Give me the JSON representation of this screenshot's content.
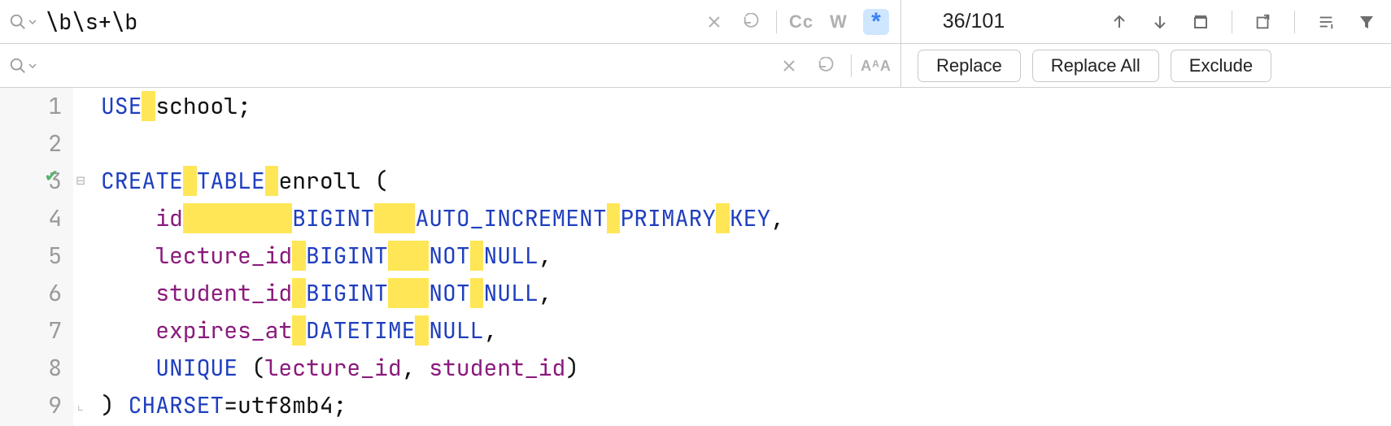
{
  "search": {
    "query": "\\b\\s+\\b",
    "match_count": "36/101",
    "cc_label": "Cc",
    "w_label": "W",
    "regex_label": "*"
  },
  "replace": {
    "value": "",
    "buttons": {
      "replace": "Replace",
      "replace_all": "Replace All",
      "exclude": "Exclude"
    },
    "aa_label": "AᴬA"
  },
  "gutter": {
    "lines": [
      "1",
      "2",
      "3",
      "4",
      "5",
      "6",
      "7",
      "8",
      "9"
    ]
  },
  "code": {
    "l1": {
      "a": "USE",
      "sp": " ",
      "b": "school",
      "c": ";"
    },
    "l2": {},
    "l3": {
      "a": "CREATE",
      "sp1": " ",
      "b": "TABLE",
      "sp2": " ",
      "c": "enroll",
      "d": " ("
    },
    "l4": {
      "indent": "    ",
      "a": "id",
      "sp1": "        ",
      "b": "BIGINT",
      "sp2": "   ",
      "c": "AUTO_INCREMENT",
      "sp3": " ",
      "d": "PRIMARY",
      "sp4": " ",
      "e": "KEY",
      "f": ","
    },
    "l5": {
      "indent": "    ",
      "a": "lecture_id",
      "sp1": " ",
      "b": "BIGINT",
      "sp2": "   ",
      "c": "NOT",
      "sp3": " ",
      "d": "NULL",
      "e": ","
    },
    "l6": {
      "indent": "    ",
      "a": "student_id",
      "sp1": " ",
      "b": "BIGINT",
      "sp2": "   ",
      "c": "NOT",
      "sp3": " ",
      "d": "NULL",
      "e": ","
    },
    "l7": {
      "indent": "    ",
      "a": "expires_at",
      "sp1": " ",
      "b": "DATETIME",
      "sp2": " ",
      "c": "NULL",
      "d": ","
    },
    "l8": {
      "indent": "    ",
      "a": "UNIQUE",
      "b": " (",
      "c": "lecture_id",
      "d": ", ",
      "e": "student_id",
      "f": ")"
    },
    "l9": {
      "a": ") ",
      "b": "CHARSET",
      "c": "=",
      "d": "utf8mb4",
      "e": ";"
    }
  }
}
